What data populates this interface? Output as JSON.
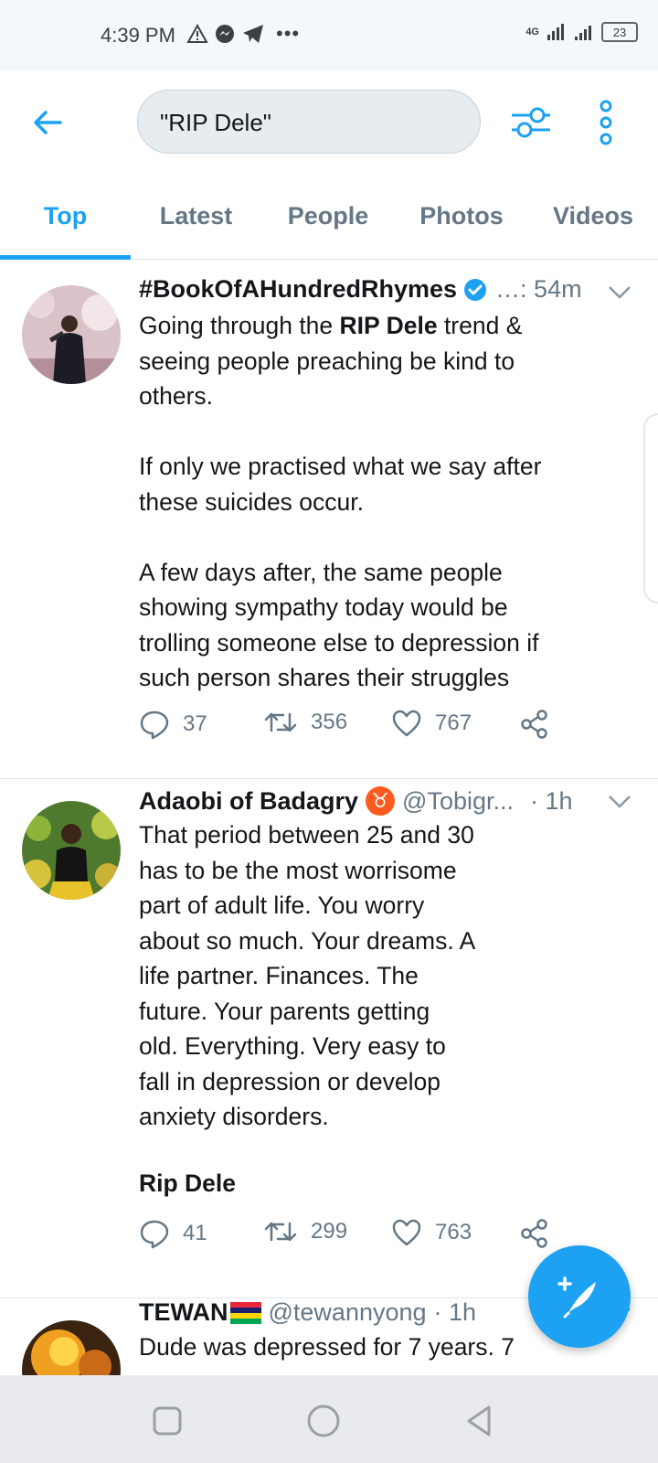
{
  "status_bar": {
    "time": "4:39 PM",
    "network": "4G",
    "battery": "23",
    "overflow": "•••"
  },
  "header": {
    "search_query": "\"RIP Dele\""
  },
  "tabs": [
    {
      "label": "Top",
      "active": true
    },
    {
      "label": "Latest",
      "active": false
    },
    {
      "label": "People",
      "active": false
    },
    {
      "label": "Photos",
      "active": false
    },
    {
      "label": "Videos",
      "active": false
    }
  ],
  "tweets": [
    {
      "name": "#BookOfAHundredRhymes",
      "verified": true,
      "handle": "",
      "meta": "…: 54m",
      "text_pre": "Going through the ",
      "text_bold": "RIP Dele",
      "text_post": " trend &\nseeing people preaching be kind to\nothers.\n\nIf only we practised what we say after\nthese suicides occur.\n\nA few days after, the same people\nshowing sympathy today would be\ntrolling someone else to depression if\nsuch person shares their struggles",
      "replies": "37",
      "retweets": "356",
      "likes": "767"
    },
    {
      "name": "Adaobi of Badagry",
      "emoji": "♉",
      "handle": "@Tobigr...",
      "meta": "· 1h",
      "text": "That period between 25 and 30\nhas to be the most worrisome\npart of adult life. You worry\nabout so much. Your dreams. A\nlife partner. Finances. The\nfuture. Your parents getting\nold. Everything. Very easy to\nfall in depression or develop\nanxiety disorders.",
      "text_bold": "Rip Dele",
      "replies": "41",
      "retweets": "299",
      "likes": "763"
    },
    {
      "name": "TEWAN",
      "handle": "@tewannyong",
      "meta": "· 1h",
      "text": "Dude was depressed for 7 years. 7"
    }
  ],
  "colors": {
    "accent": "#1da1f2",
    "secondary_text": "#657786",
    "primary_text": "#14171a"
  }
}
